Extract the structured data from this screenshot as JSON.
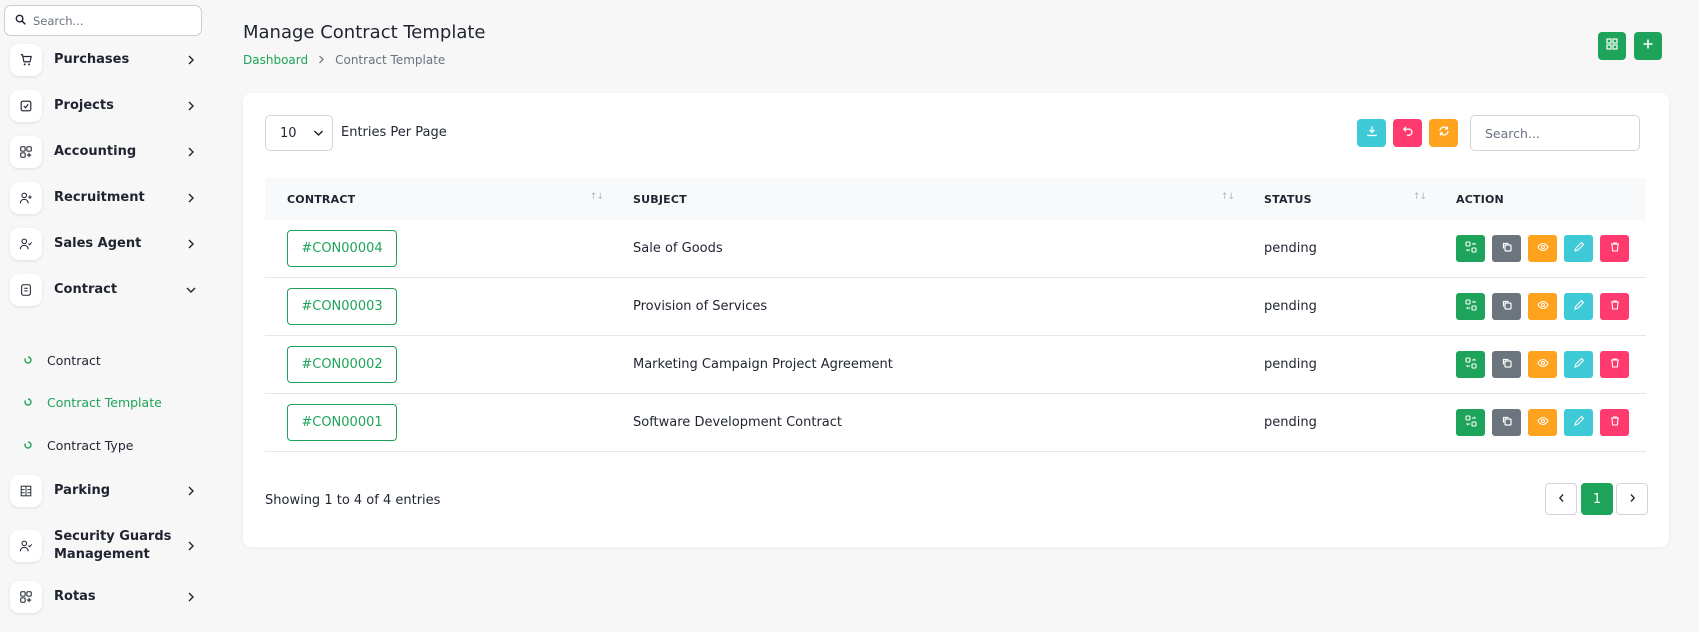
{
  "sidebar": {
    "search_placeholder": "Search...",
    "items": [
      {
        "label": "Purchases"
      },
      {
        "label": "Projects"
      },
      {
        "label": "Accounting"
      },
      {
        "label": "Recruitment"
      },
      {
        "label": "Sales Agent"
      },
      {
        "label": "Contract"
      },
      {
        "label": "Parking"
      },
      {
        "label": "Security Guards Management"
      },
      {
        "label": "Rotas"
      }
    ],
    "sub_items": [
      {
        "label": "Contract"
      },
      {
        "label": "Contract Template",
        "active": true
      },
      {
        "label": "Contract Type"
      }
    ]
  },
  "header": {
    "title": "Manage Contract Template",
    "breadcrumb": {
      "link": "Dashboard",
      "current": "Contract Template"
    }
  },
  "table_controls": {
    "entries_value": "10",
    "entries_label": "Entries Per Page",
    "search_placeholder": "Search..."
  },
  "table": {
    "columns": [
      "CONTRACT",
      "SUBJECT",
      "STATUS",
      "ACTION"
    ],
    "rows": [
      {
        "contract": "#CON00004",
        "subject": "Sale of Goods",
        "status": "pending"
      },
      {
        "contract": "#CON00003",
        "subject": "Provision of Services",
        "status": "pending"
      },
      {
        "contract": "#CON00002",
        "subject": "Marketing Campaign Project Agreement",
        "status": "pending"
      },
      {
        "contract": "#CON00001",
        "subject": "Software Development Contract",
        "status": "pending"
      }
    ]
  },
  "footer": {
    "showing": "Showing 1 to 4 of 4 entries",
    "current_page": "1"
  },
  "colors": {
    "primary_green": "#1ea35a",
    "cyan": "#3ec9d6",
    "pink": "#ff3a6e",
    "orange": "#ffa21d",
    "gray": "#6c757d"
  }
}
